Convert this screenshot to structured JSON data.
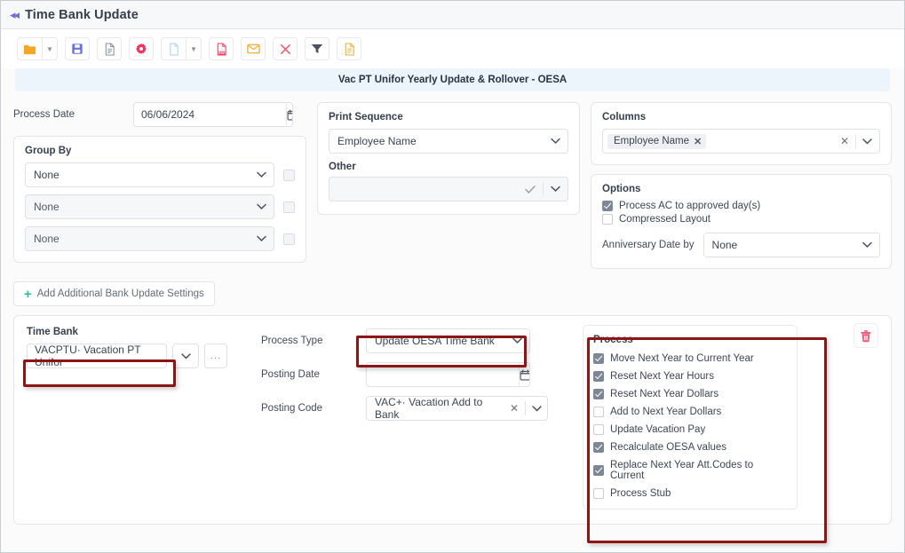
{
  "window": {
    "title": "Time Bank Update",
    "collapse_icon": "double-chevron-left-icon"
  },
  "toolbar": {
    "buttons": [
      {
        "name": "open-folder",
        "icon": "folder-icon",
        "caret": true
      },
      {
        "name": "save",
        "icon": "floppy-disk-icon",
        "caret": false
      },
      {
        "name": "document",
        "icon": "document-icon",
        "caret": false
      },
      {
        "name": "settings",
        "icon": "gear-icon",
        "caret": false
      },
      {
        "name": "new-page",
        "icon": "blank-page-icon",
        "caret": true
      },
      {
        "name": "export-pdf",
        "icon": "pdf-icon",
        "caret": false
      },
      {
        "name": "email",
        "icon": "envelope-icon",
        "caret": false
      },
      {
        "name": "cancel",
        "icon": "close-x-icon",
        "caret": false
      },
      {
        "name": "filter",
        "icon": "funnel-icon",
        "caret": false
      },
      {
        "name": "report",
        "icon": "report-document-icon",
        "caret": false
      }
    ]
  },
  "banner": {
    "text": "Vac PT Unifor Yearly Update & Rollover - OESA"
  },
  "process_date": {
    "label": "Process Date",
    "value": "06/06/2024",
    "calendar_icon": "calendar-icon"
  },
  "group_by": {
    "title": "Group By",
    "rows": [
      {
        "value": "None",
        "checked": false
      },
      {
        "value": "None",
        "checked": false
      },
      {
        "value": "None",
        "checked": false
      }
    ]
  },
  "print_sequence": {
    "title": "Print Sequence",
    "value": "Employee Name",
    "other_label": "Other",
    "other_value": ""
  },
  "columns": {
    "title": "Columns",
    "chips": [
      "Employee Name"
    ]
  },
  "options": {
    "title": "Options",
    "checkboxes": [
      {
        "label": "Process AC to approved day(s)",
        "checked": true
      },
      {
        "label": "Compressed Layout",
        "checked": false
      }
    ],
    "anniversary_label": "Anniversary Date by",
    "anniversary_value": "None"
  },
  "add_settings": {
    "label": "Add Additional Bank Update Settings",
    "plus_icon": "plus-icon"
  },
  "time_bank": {
    "label": "Time Bank",
    "value": "VACPTU· Vacation PT Unifor",
    "more_button": "...",
    "highlighted": true
  },
  "process_type": {
    "label": "Process Type",
    "value": "Update OESA Time Bank",
    "highlighted": true
  },
  "posting_date": {
    "label": "Posting Date",
    "value": ""
  },
  "posting_code": {
    "label": "Posting Code",
    "value": "VAC+· Vacation Add to Bank"
  },
  "process": {
    "title": "Process",
    "highlighted": true,
    "checkboxes": [
      {
        "label": "Move Next Year to Current Year",
        "checked": true
      },
      {
        "label": "Reset Next Year Hours",
        "checked": true
      },
      {
        "label": "Reset Next Year Dollars",
        "checked": true
      },
      {
        "label": "Add to Next Year Dollars",
        "checked": false
      },
      {
        "label": "Update Vacation Pay",
        "checked": false
      },
      {
        "label": "Recalculate OESA values",
        "checked": true
      },
      {
        "label": "Replace Next Year Att.Codes to Current",
        "checked": true
      },
      {
        "label": "Process Stub",
        "checked": false
      }
    ]
  },
  "delete": {
    "icon": "trash-icon"
  },
  "colors": {
    "banner_bg": "#ecf4fc",
    "highlight_border": "#8c1616",
    "accent_green": "#2bbf9a",
    "folder_orange": "#f5a623",
    "save_purple": "#6a72d6",
    "gear_red": "#f0325c",
    "pdf_red": "#e8415c",
    "trash_pink": "#ef5a7d"
  }
}
